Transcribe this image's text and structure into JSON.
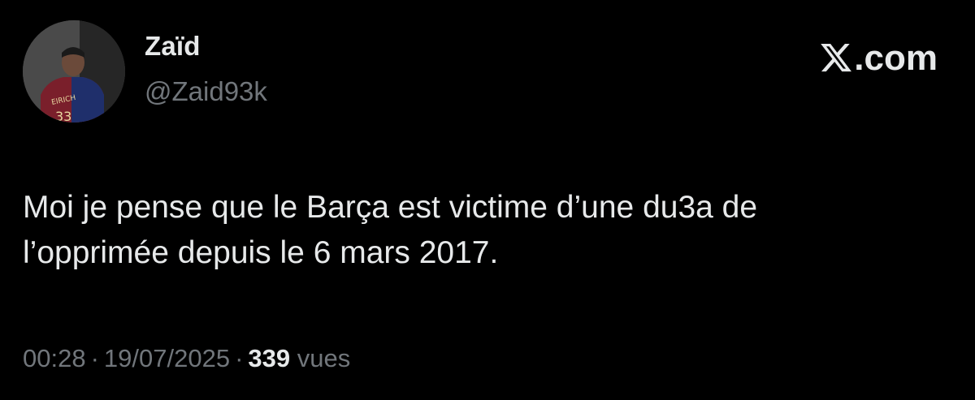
{
  "author": {
    "display_name": "Zaïd",
    "handle": "@Zaid93k",
    "avatar_icon": "profile-photo"
  },
  "brand": {
    "logo_icon": "x-logo-icon",
    "text": ".com"
  },
  "tweet": {
    "text": "Moi je pense que le Barça est victime d’une du3a de\nl’opprimée depuis le 6 mars 2017."
  },
  "meta": {
    "time": "00:28",
    "separator": "·",
    "date": "19/07/2025",
    "views_count": "339",
    "views_label": "vues"
  },
  "colors": {
    "background": "#000000",
    "text_primary": "#e7e9ea",
    "text_secondary": "#71767b"
  }
}
